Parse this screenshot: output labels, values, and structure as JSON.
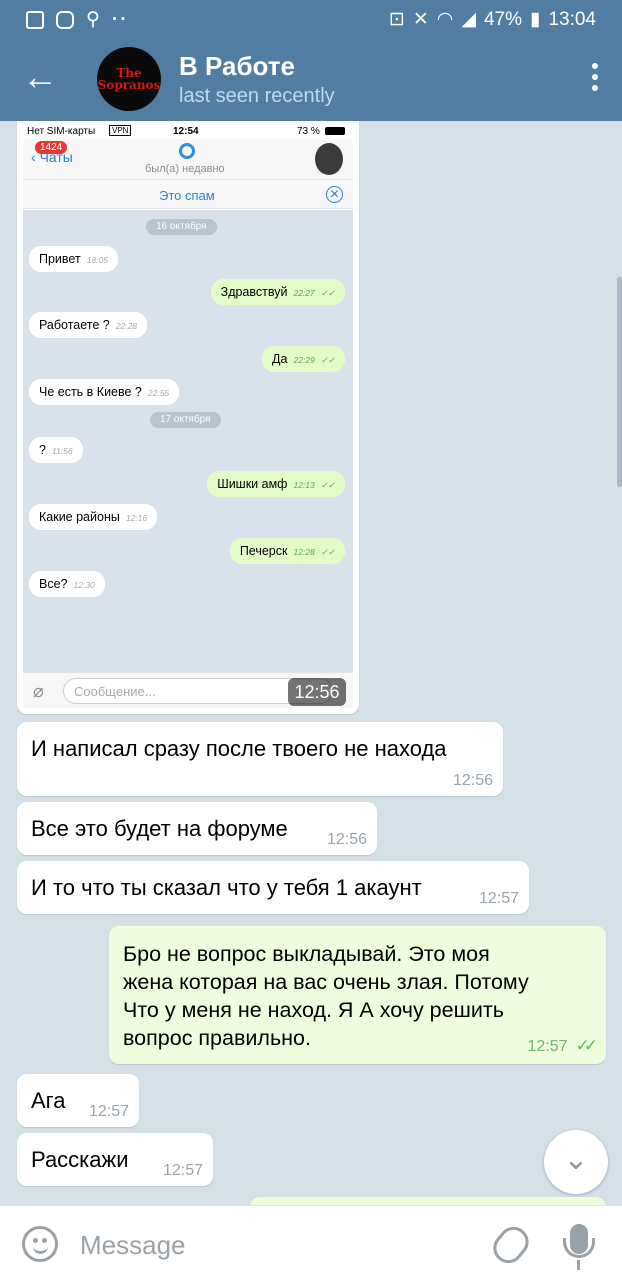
{
  "statusbar": {
    "battery": "47%",
    "time": "13:04"
  },
  "header": {
    "title": "В Работе",
    "subtitle": "last seen recently",
    "avatar_text_1": "The",
    "avatar_text_2": "Sopranos"
  },
  "image_message": {
    "time": "12:56",
    "screenshot": {
      "carrier": "Нет SIM-карты",
      "vpn": "VPN",
      "time": "12:54",
      "battery": "73 %",
      "back_label": "Чаты",
      "badge": "1424",
      "status": "был(а) недавно",
      "spam_label": "Это спам",
      "dates": [
        "16 октября",
        "17 октября"
      ],
      "messages": [
        {
          "text": "Привет",
          "time": "18:05"
        },
        {
          "text": "Здравствуй",
          "time": "22:27"
        },
        {
          "text": "Работаете ?",
          "time": "22:28"
        },
        {
          "text": "Да",
          "time": "22:29"
        },
        {
          "text": "Че есть в Киеве ?",
          "time": "22:55"
        },
        {
          "text": "?",
          "time": "11:56"
        },
        {
          "text": "Шишки амф",
          "time": "12:13"
        },
        {
          "text": "Какие районы",
          "time": "12:16"
        },
        {
          "text": "Печерск",
          "time": "12:28"
        },
        {
          "text": "Все?",
          "time": "12:30"
        }
      ],
      "input_placeholder": "Сообщение..."
    }
  },
  "messages": [
    {
      "text": "И написал сразу после твоего не находа",
      "time": "12:56"
    },
    {
      "text": "Все это будет на форуме",
      "time": "12:56"
    },
    {
      "text": "И то что ты сказал что у тебя 1 акаунт",
      "time": "12:57"
    },
    {
      "text": "Бро не вопрос выкладывай. Это моя\nжена которая на вас очень злая. Потому\nЧто у меня не наход. Я А хочу решить\nвопрос правильно.",
      "time": "12:57"
    },
    {
      "text": "Ага",
      "time": "12:57"
    },
    {
      "text": "Расскажи",
      "time": "12:57"
    }
  ],
  "composer": {
    "placeholder": "Message"
  },
  "icons": {
    "back": "arrow-left-icon",
    "menu": "more-vert-icon",
    "scroll": "chevron-down-icon",
    "emoji": "emoji-icon",
    "attach": "paperclip-icon",
    "mic": "microphone-icon"
  },
  "colors": {
    "header": "#517da2",
    "incoming": "#ffffff",
    "outgoing": "#effdde",
    "background": "#d5dfe6"
  }
}
